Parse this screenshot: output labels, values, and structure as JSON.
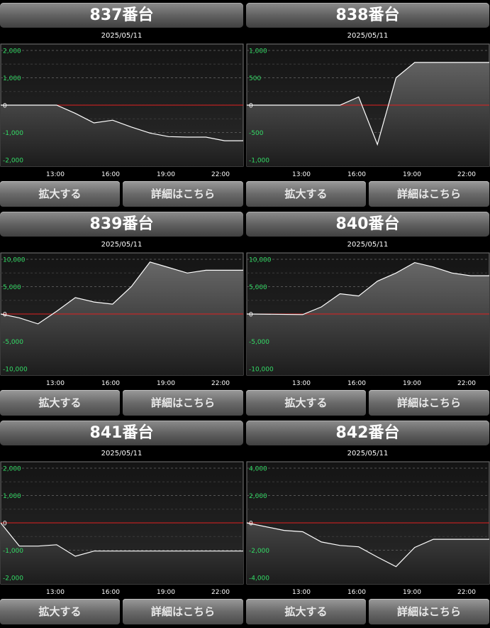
{
  "buttons": {
    "zoom": "拡大する",
    "detail": "詳細はこちら"
  },
  "colors": {
    "line": "#ffffff",
    "zero_line": "#e02020",
    "y_tick": "#33dd66",
    "x_tick": "#ffffff"
  },
  "chart_data": [
    {
      "type": "area",
      "title": "837番台",
      "subtitle": "2025/05/11",
      "x_ticks": [
        "13:00",
        "16:00",
        "19:00",
        "22:00"
      ],
      "y_ticks": [
        2000,
        1000,
        0,
        -1000,
        -2000
      ],
      "y_tick_labels": [
        "2,000",
        "1,000",
        "0",
        "-1,000",
        "-2,000"
      ],
      "ylim": [
        -2000,
        2000
      ],
      "xlim": [
        10,
        23
      ],
      "grid": true,
      "x": [
        10,
        13,
        14,
        15,
        16,
        17,
        18,
        19,
        20,
        21,
        22,
        23
      ],
      "y": [
        0,
        0,
        -300,
        -650,
        -550,
        -800,
        -1020,
        -1150,
        -1170,
        -1170,
        -1300,
        -1300
      ]
    },
    {
      "type": "area",
      "title": "838番台",
      "subtitle": "2025/05/11",
      "x_ticks": [
        "13:00",
        "16:00",
        "19:00",
        "22:00"
      ],
      "y_ticks": [
        1000,
        500,
        0,
        -500,
        -1000
      ],
      "y_tick_labels": [
        "1,000",
        "500",
        "0",
        "-500",
        "-1,000"
      ],
      "ylim": [
        -1000,
        1000
      ],
      "xlim": [
        10,
        23
      ],
      "grid": true,
      "x": [
        10,
        15,
        16,
        17,
        18,
        19,
        20,
        21,
        22,
        23
      ],
      "y": [
        0,
        0,
        150,
        -720,
        500,
        780,
        780,
        780,
        780,
        780
      ]
    },
    {
      "type": "area",
      "title": "839番台",
      "subtitle": "2025/05/11",
      "x_ticks": [
        "13:00",
        "16:00",
        "19:00",
        "22:00"
      ],
      "y_ticks": [
        10000,
        5000,
        0,
        -5000,
        -10000
      ],
      "y_tick_labels": [
        "10,000",
        "5,000",
        "0",
        "-5,000",
        "-10,000"
      ],
      "ylim": [
        -10000,
        10000
      ],
      "xlim": [
        10,
        23
      ],
      "grid": true,
      "x": [
        10,
        11,
        12,
        13,
        14,
        15,
        16,
        17,
        18,
        19,
        20,
        21,
        22,
        23
      ],
      "y": [
        0,
        -700,
        -1800,
        500,
        3000,
        2200,
        1800,
        5000,
        9500,
        8500,
        7500,
        8000,
        8000,
        8000
      ]
    },
    {
      "type": "area",
      "title": "840番台",
      "subtitle": "2025/05/11",
      "x_ticks": [
        "13:00",
        "16:00",
        "19:00",
        "22:00"
      ],
      "y_ticks": [
        10000,
        5000,
        0,
        -5000,
        -10000
      ],
      "y_tick_labels": [
        "10,000",
        "5,000",
        "0",
        "-5,000",
        "-10,000"
      ],
      "ylim": [
        -10000,
        10000
      ],
      "xlim": [
        10,
        23
      ],
      "grid": true,
      "x": [
        10,
        13,
        14,
        15,
        16,
        17,
        18,
        19,
        20,
        21,
        22,
        23
      ],
      "y": [
        0,
        -100,
        1300,
        3700,
        3300,
        6000,
        7500,
        9400,
        8600,
        7500,
        7000,
        7000
      ]
    },
    {
      "type": "area",
      "title": "841番台",
      "subtitle": "2025/05/11",
      "x_ticks": [
        "13:00",
        "16:00",
        "19:00",
        "22:00"
      ],
      "y_ticks": [
        2000,
        1000,
        0,
        -1000,
        -2000
      ],
      "y_tick_labels": [
        "2,000",
        "1,000",
        "0",
        "-1,000",
        "-2,000"
      ],
      "ylim": [
        -2000,
        2000
      ],
      "xlim": [
        10,
        23
      ],
      "grid": true,
      "x": [
        10,
        11,
        12,
        13,
        14,
        15,
        16,
        17,
        18,
        19,
        20,
        21,
        22,
        23
      ],
      "y": [
        0,
        -850,
        -850,
        -800,
        -1220,
        -1030,
        -1030,
        -1030,
        -1030,
        -1030,
        -1030,
        -1030,
        -1030,
        -1030
      ]
    },
    {
      "type": "area",
      "title": "842番台",
      "subtitle": "2025/05/11",
      "x_ticks": [
        "13:00",
        "16:00",
        "19:00",
        "22:00"
      ],
      "y_ticks": [
        4000,
        2000,
        0,
        -2000,
        -4000
      ],
      "y_tick_labels": [
        "4,000",
        "2,000",
        "0",
        "-2,000",
        "-4,000"
      ],
      "ylim": [
        -4000,
        4000
      ],
      "xlim": [
        10,
        23
      ],
      "grid": true,
      "x": [
        10,
        12,
        13,
        14,
        15,
        16,
        17,
        18,
        19,
        20,
        21,
        22,
        23
      ],
      "y": [
        0,
        -550,
        -650,
        -1400,
        -1650,
        -1750,
        -2500,
        -3200,
        -1800,
        -1200,
        -1200,
        -1200,
        -1200
      ]
    }
  ]
}
